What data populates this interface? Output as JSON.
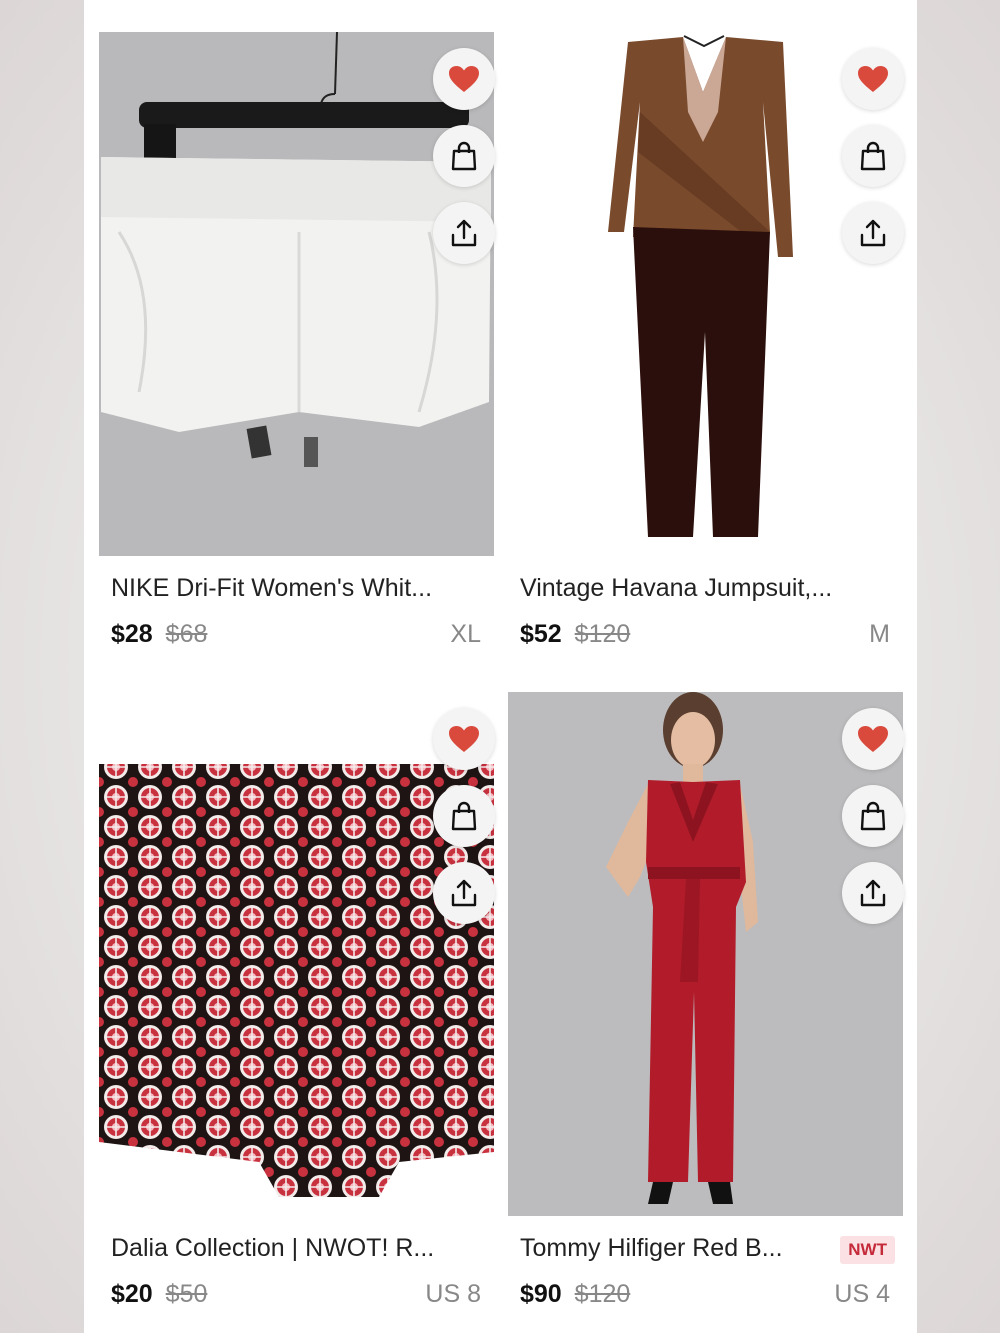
{
  "products": [
    {
      "title": "NIKE Dri-Fit Women's Whit...",
      "price": "$28",
      "original_price": "$68",
      "size": "XL",
      "image": "white-shorts-on-hanger"
    },
    {
      "title": "Vintage Havana Jumpsuit,...",
      "price": "$52",
      "original_price": "$120",
      "size": "M",
      "image": "brown-black-jumpsuit"
    },
    {
      "title": "Dalia Collection | NWOT! R...",
      "price": "$20",
      "original_price": "$50",
      "size": "US 8",
      "image": "red-patterned-shorts"
    },
    {
      "title": "Tommy Hilfiger Red B...",
      "badge": "NWT",
      "price": "$90",
      "original_price": "$120",
      "size": "US 4",
      "image": "model-red-jumpsuit"
    }
  ],
  "icons": {
    "like": "heart-icon",
    "bag": "shopping-bag-icon",
    "share": "share-icon"
  },
  "colors": {
    "heart": "#d94a3d",
    "badge_bg": "#fbe1e3",
    "badge_text": "#c42a3a"
  }
}
